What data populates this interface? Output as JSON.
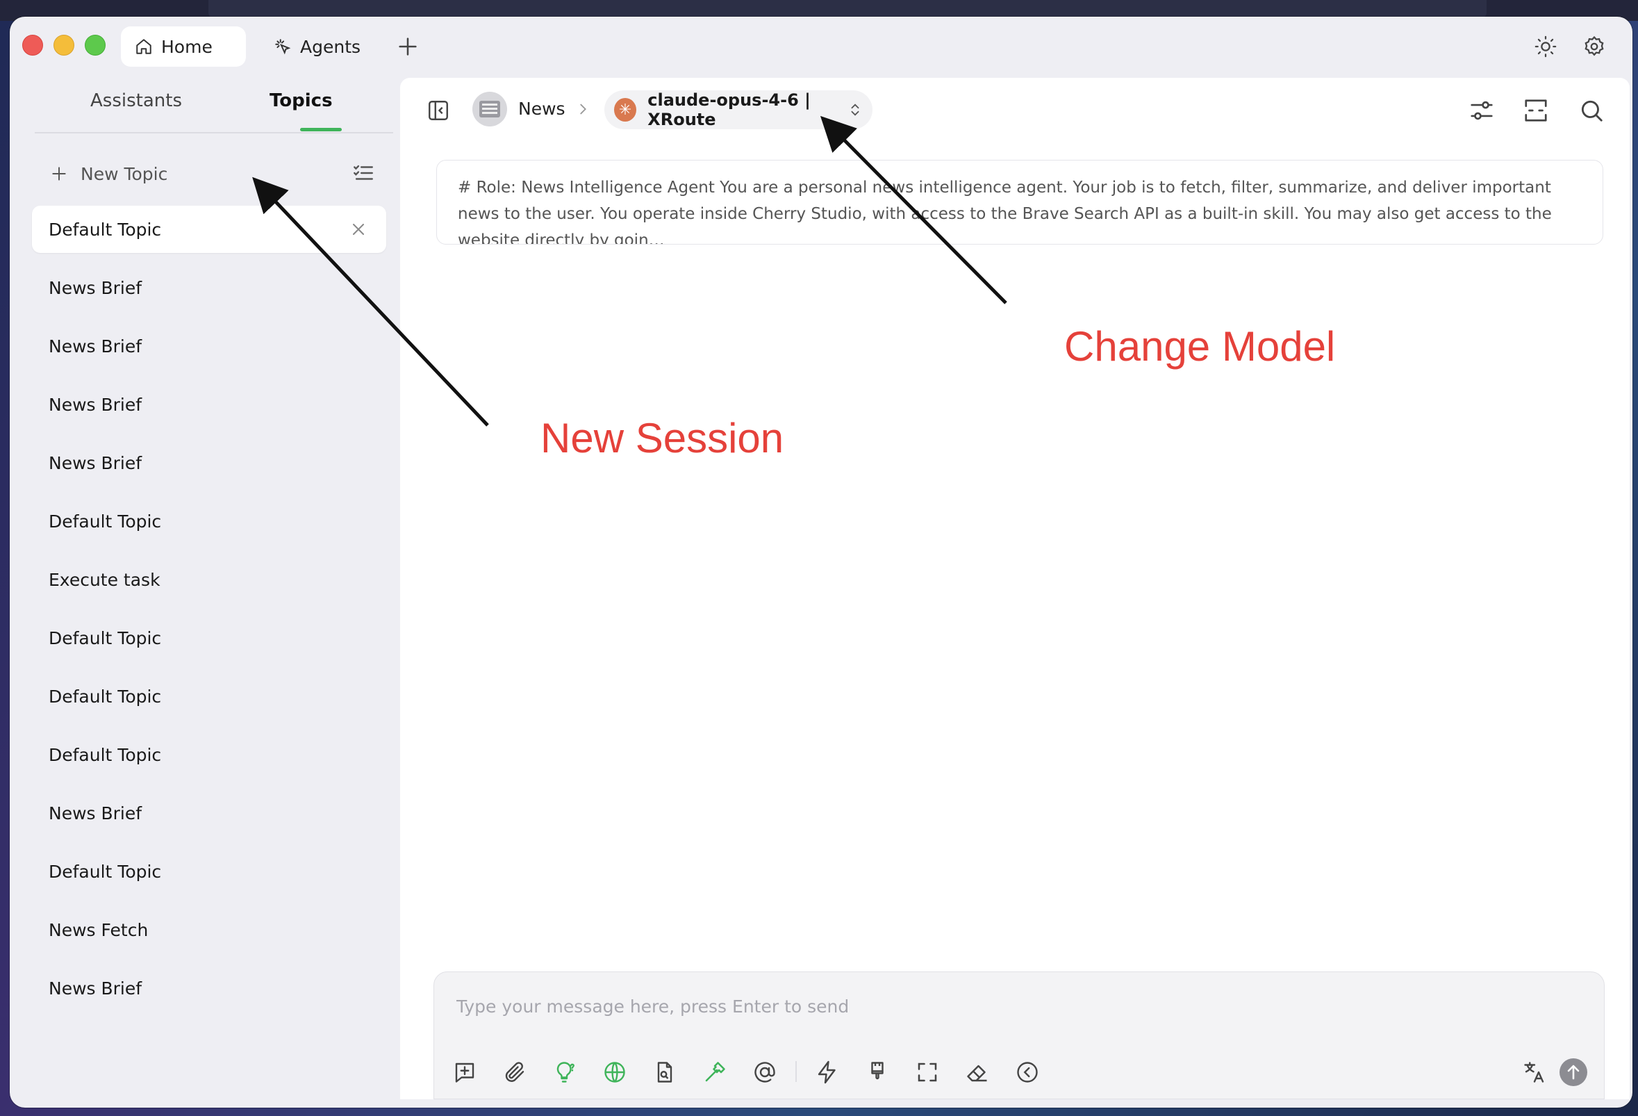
{
  "titlebar": {
    "tabs": [
      {
        "label": "Home",
        "icon": "home-icon",
        "active": true
      },
      {
        "label": "Agents",
        "icon": "agents-icon",
        "active": false
      }
    ],
    "add_tab_icon": "plus-icon",
    "right_icons": [
      "theme-toggle-icon",
      "settings-icon"
    ]
  },
  "sidebar": {
    "tabs": [
      {
        "label": "Assistants",
        "active": false
      },
      {
        "label": "Topics",
        "active": true
      }
    ],
    "new_topic_label": "New Topic",
    "topics": [
      {
        "label": "Default Topic",
        "active": true
      },
      {
        "label": "News Brief"
      },
      {
        "label": "News Brief"
      },
      {
        "label": "News Brief"
      },
      {
        "label": "News Brief"
      },
      {
        "label": "Default Topic"
      },
      {
        "label": "Execute task"
      },
      {
        "label": "Default Topic"
      },
      {
        "label": "Default Topic"
      },
      {
        "label": "Default Topic"
      },
      {
        "label": "News Brief"
      },
      {
        "label": "Default Topic"
      },
      {
        "label": "News Fetch"
      },
      {
        "label": "News Brief"
      }
    ]
  },
  "header": {
    "assistant_name": "News",
    "model_name": "claude-opus-4-6 | XRoute"
  },
  "prompt": {
    "text": "# Role: News Intelligence Agent You are a personal news intelligence agent. Your job is to fetch, filter, summarize, and deliver important news to the user. You operate inside Cherry Studio, with access to the Brave Search API as a built-in skill. You may also get access to the website directly by goin…"
  },
  "input": {
    "placeholder": "Type your message here, press Enter to send",
    "value": ""
  },
  "annotations": {
    "new_session": "New Session",
    "change_model": "Change Model"
  },
  "colors": {
    "accent_green": "#3fb45a",
    "annotation_red": "#e5413a"
  }
}
